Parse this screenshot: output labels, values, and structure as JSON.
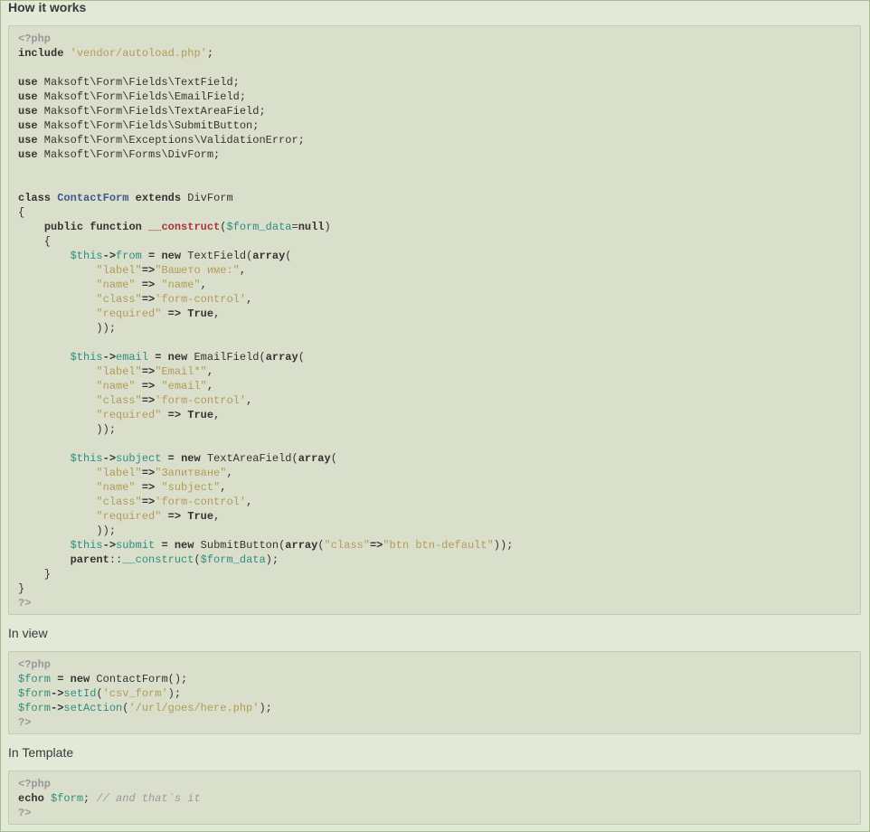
{
  "sections": {
    "how_it_works": "How it works",
    "in_view": "In view",
    "in_template": "In Template"
  },
  "code_main": [
    [
      [
        "t",
        "<?php"
      ]
    ],
    [
      [
        "k",
        "include"
      ],
      [
        "n",
        " "
      ],
      [
        "s",
        "'vendor/autoload.php'"
      ],
      [
        "n",
        ";"
      ]
    ],
    [],
    [
      [
        "k",
        "use"
      ],
      [
        "n",
        " Maksoft\\Form\\Fields\\TextField;"
      ]
    ],
    [
      [
        "k",
        "use"
      ],
      [
        "n",
        " Maksoft\\Form\\Fields\\EmailField;"
      ]
    ],
    [
      [
        "k",
        "use"
      ],
      [
        "n",
        " Maksoft\\Form\\Fields\\TextAreaField;"
      ]
    ],
    [
      [
        "k",
        "use"
      ],
      [
        "n",
        " Maksoft\\Form\\Fields\\SubmitButton;"
      ]
    ],
    [
      [
        "k",
        "use"
      ],
      [
        "n",
        " Maksoft\\Form\\Exceptions\\ValidationError;"
      ]
    ],
    [
      [
        "k",
        "use"
      ],
      [
        "n",
        " Maksoft\\Form\\Forms\\DivForm;"
      ]
    ],
    [],
    [],
    [
      [
        "k",
        "class"
      ],
      [
        "n",
        " "
      ],
      [
        "c",
        "ContactForm"
      ],
      [
        "n",
        " "
      ],
      [
        "k",
        "extends"
      ],
      [
        "n",
        " DivForm"
      ]
    ],
    [
      [
        "n",
        "{"
      ]
    ],
    [
      [
        "n",
        "    "
      ],
      [
        "k",
        "public"
      ],
      [
        "n",
        " "
      ],
      [
        "k",
        "function"
      ],
      [
        "n",
        " "
      ],
      [
        "f",
        "__construct"
      ],
      [
        "n",
        "("
      ],
      [
        "v",
        "$form_data"
      ],
      [
        "n",
        "="
      ],
      [
        "k",
        "null"
      ],
      [
        "n",
        ")"
      ]
    ],
    [
      [
        "n",
        "    {"
      ]
    ],
    [
      [
        "n",
        "        "
      ],
      [
        "v",
        "$this"
      ],
      [
        "k",
        "->"
      ],
      [
        "m",
        "from"
      ],
      [
        "n",
        " "
      ],
      [
        "k",
        "="
      ],
      [
        "n",
        " "
      ],
      [
        "k",
        "new"
      ],
      [
        "n",
        " TextField("
      ],
      [
        "k",
        "array"
      ],
      [
        "n",
        "("
      ]
    ],
    [
      [
        "n",
        "            "
      ],
      [
        "s",
        "\"label\""
      ],
      [
        "k",
        "=>"
      ],
      [
        "s",
        "\"Вашето име:\""
      ],
      [
        "n",
        ","
      ]
    ],
    [
      [
        "n",
        "            "
      ],
      [
        "s",
        "\"name\""
      ],
      [
        "n",
        " "
      ],
      [
        "k",
        "=>"
      ],
      [
        "n",
        " "
      ],
      [
        "s",
        "\"name\""
      ],
      [
        "n",
        ","
      ]
    ],
    [
      [
        "n",
        "            "
      ],
      [
        "s",
        "\"class\""
      ],
      [
        "k",
        "=>"
      ],
      [
        "s",
        "'form-control'"
      ],
      [
        "n",
        ","
      ]
    ],
    [
      [
        "n",
        "            "
      ],
      [
        "s",
        "\"required\""
      ],
      [
        "n",
        " "
      ],
      [
        "k",
        "=>"
      ],
      [
        "n",
        " "
      ],
      [
        "k",
        "True"
      ],
      [
        "n",
        ","
      ]
    ],
    [
      [
        "n",
        "            ));"
      ]
    ],
    [],
    [
      [
        "n",
        "        "
      ],
      [
        "v",
        "$this"
      ],
      [
        "k",
        "->"
      ],
      [
        "m",
        "email"
      ],
      [
        "n",
        " "
      ],
      [
        "k",
        "="
      ],
      [
        "n",
        " "
      ],
      [
        "k",
        "new"
      ],
      [
        "n",
        " EmailField("
      ],
      [
        "k",
        "array"
      ],
      [
        "n",
        "("
      ]
    ],
    [
      [
        "n",
        "            "
      ],
      [
        "s",
        "\"label\""
      ],
      [
        "k",
        "=>"
      ],
      [
        "s",
        "\"Email*\""
      ],
      [
        "n",
        ","
      ]
    ],
    [
      [
        "n",
        "            "
      ],
      [
        "s",
        "\"name\""
      ],
      [
        "n",
        " "
      ],
      [
        "k",
        "=>"
      ],
      [
        "n",
        " "
      ],
      [
        "s",
        "\"email\""
      ],
      [
        "n",
        ","
      ]
    ],
    [
      [
        "n",
        "            "
      ],
      [
        "s",
        "\"class\""
      ],
      [
        "k",
        "=>"
      ],
      [
        "s",
        "'form-control'"
      ],
      [
        "n",
        ","
      ]
    ],
    [
      [
        "n",
        "            "
      ],
      [
        "s",
        "\"required\""
      ],
      [
        "n",
        " "
      ],
      [
        "k",
        "=>"
      ],
      [
        "n",
        " "
      ],
      [
        "k",
        "True"
      ],
      [
        "n",
        ","
      ]
    ],
    [
      [
        "n",
        "            ));"
      ]
    ],
    [],
    [
      [
        "n",
        "        "
      ],
      [
        "v",
        "$this"
      ],
      [
        "k",
        "->"
      ],
      [
        "m",
        "subject"
      ],
      [
        "n",
        " "
      ],
      [
        "k",
        "="
      ],
      [
        "n",
        " "
      ],
      [
        "k",
        "new"
      ],
      [
        "n",
        " TextAreaField("
      ],
      [
        "k",
        "array"
      ],
      [
        "n",
        "("
      ]
    ],
    [
      [
        "n",
        "            "
      ],
      [
        "s",
        "\"label\""
      ],
      [
        "k",
        "=>"
      ],
      [
        "s",
        "\"Запитване\""
      ],
      [
        "n",
        ","
      ]
    ],
    [
      [
        "n",
        "            "
      ],
      [
        "s",
        "\"name\""
      ],
      [
        "n",
        " "
      ],
      [
        "k",
        "=>"
      ],
      [
        "n",
        " "
      ],
      [
        "s",
        "\"subject\""
      ],
      [
        "n",
        ","
      ]
    ],
    [
      [
        "n",
        "            "
      ],
      [
        "s",
        "\"class\""
      ],
      [
        "k",
        "=>"
      ],
      [
        "s",
        "'form-control'"
      ],
      [
        "n",
        ","
      ]
    ],
    [
      [
        "n",
        "            "
      ],
      [
        "s",
        "\"required\""
      ],
      [
        "n",
        " "
      ],
      [
        "k",
        "=>"
      ],
      [
        "n",
        " "
      ],
      [
        "k",
        "True"
      ],
      [
        "n",
        ","
      ]
    ],
    [
      [
        "n",
        "            ));"
      ]
    ],
    [
      [
        "n",
        "        "
      ],
      [
        "v",
        "$this"
      ],
      [
        "k",
        "->"
      ],
      [
        "m",
        "submit"
      ],
      [
        "n",
        " "
      ],
      [
        "k",
        "="
      ],
      [
        "n",
        " "
      ],
      [
        "k",
        "new"
      ],
      [
        "n",
        " SubmitButton("
      ],
      [
        "k",
        "array"
      ],
      [
        "n",
        "("
      ],
      [
        "s",
        "\"class\""
      ],
      [
        "k",
        "=>"
      ],
      [
        "s",
        "\"btn btn-default\""
      ],
      [
        "n",
        "));"
      ]
    ],
    [
      [
        "n",
        "        "
      ],
      [
        "k",
        "parent"
      ],
      [
        "n",
        "::"
      ],
      [
        "m",
        "__construct"
      ],
      [
        "n",
        "("
      ],
      [
        "v",
        "$form_data"
      ],
      [
        "n",
        ");"
      ]
    ],
    [
      [
        "n",
        "    }"
      ]
    ],
    [
      [
        "n",
        "}"
      ]
    ],
    [
      [
        "t",
        "?>"
      ]
    ]
  ],
  "code_view": [
    [
      [
        "t",
        "<?php"
      ]
    ],
    [
      [
        "v",
        "$form"
      ],
      [
        "n",
        " "
      ],
      [
        "k",
        "="
      ],
      [
        "n",
        " "
      ],
      [
        "k",
        "new"
      ],
      [
        "n",
        " ContactForm();"
      ]
    ],
    [
      [
        "v",
        "$form"
      ],
      [
        "k",
        "->"
      ],
      [
        "m",
        "setId"
      ],
      [
        "n",
        "("
      ],
      [
        "s",
        "'csv_form'"
      ],
      [
        "n",
        ");"
      ]
    ],
    [
      [
        "v",
        "$form"
      ],
      [
        "k",
        "->"
      ],
      [
        "m",
        "setAction"
      ],
      [
        "n",
        "("
      ],
      [
        "s",
        "'/url/goes/here.php'"
      ],
      [
        "n",
        ");"
      ]
    ],
    [
      [
        "t",
        "?>"
      ]
    ]
  ],
  "code_template": [
    [
      [
        "t",
        "<?php"
      ]
    ],
    [
      [
        "k",
        "echo"
      ],
      [
        "n",
        " "
      ],
      [
        "v",
        "$form"
      ],
      [
        "n",
        "; "
      ],
      [
        "cm",
        "// and that`s it"
      ]
    ],
    [
      [
        "t",
        "?>"
      ]
    ]
  ]
}
